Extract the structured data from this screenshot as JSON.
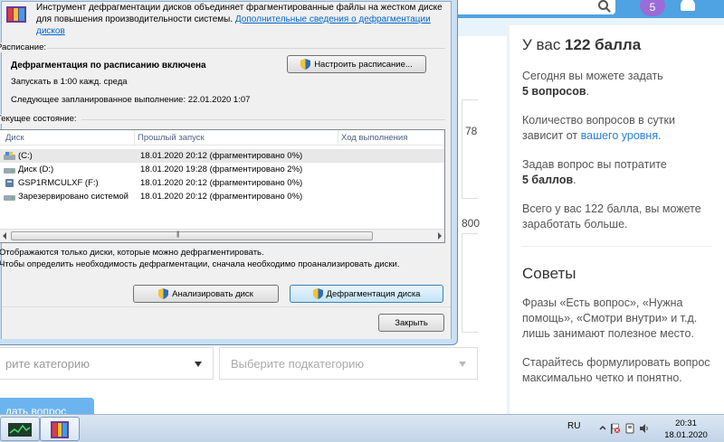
{
  "web": {
    "avatar_text": "5",
    "stray_78": "78",
    "stray_800": "800",
    "select_category_placeholder": "рите категорию",
    "select_subcategory_placeholder": "Выберите подкатегорию",
    "ask_button": "дать вопрос",
    "sidebar": {
      "points_prefix": "У вас ",
      "points_value": "122 балла",
      "today_text": "Сегодня вы можете задать",
      "today_value": "5 вопросов",
      "today_suffix": ".",
      "limit_text": "Количество вопросов в сутки зависит от ",
      "limit_link": "вашего уровня",
      "limit_suffix": ".",
      "spend_text": "Задав вопрос вы потратите",
      "spend_value": "5 баллов",
      "spend_suffix": ".",
      "total_text": "Всего у вас 122 балла, вы можете заработать больше.",
      "advice_title": "Советы",
      "advice_1": "Фразы «Есть вопрос», «Нужна помощь», «Смотри внутри» и т.д. лишь занимают полезное место.",
      "advice_2": "Старайтесь формулировать вопрос максимально четко и понятно."
    }
  },
  "dialog": {
    "intro_text": "Инструмент дефрагментации дисков объединяет фрагментированные файлы на жестком диске для повышения производительности системы. ",
    "intro_link": "Дополнительные сведения о дефрагментации дисков",
    "schedule_label": "Расписание:",
    "schedule_status": "Дефрагментация по расписанию включена",
    "schedule_run": "Запускать в 1:00 кажд. среда",
    "schedule_next": "Следующее запланированное выполнение: 22.01.2020 1:07",
    "configure_button": "Настроить расписание...",
    "current_state_label": "Текущее состояние:",
    "columns": [
      "Диск",
      "Прошлый запуск",
      "Ход выполнения"
    ],
    "disks": [
      {
        "name": "(C:)",
        "last_run": "18.01.2020 20:12 (фрагментировано 0%)"
      },
      {
        "name": "Диск (D:)",
        "last_run": "18.01.2020 19:28 (фрагментировано 2%)"
      },
      {
        "name": "GSP1RMCULXF (F:)",
        "last_run": "18.01.2020 20:12 (фрагментировано 0%)"
      },
      {
        "name": "Зарезервировано системой",
        "last_run": "18.01.2020 20:12 (фрагментировано 0%)"
      }
    ],
    "info_1": "Отображаются только диски, которые можно дефрагментировать.",
    "info_2": "Чтобы определить необходимость дефрагментации, сначала необходимо проанализировать диски.",
    "analyze_button": "Анализировать диск",
    "defrag_button": "Дефрагментация диска",
    "close_button": "Закрыть"
  },
  "taskbar": {
    "language": "RU",
    "time": "20:31",
    "date": "18.01.2020"
  }
}
